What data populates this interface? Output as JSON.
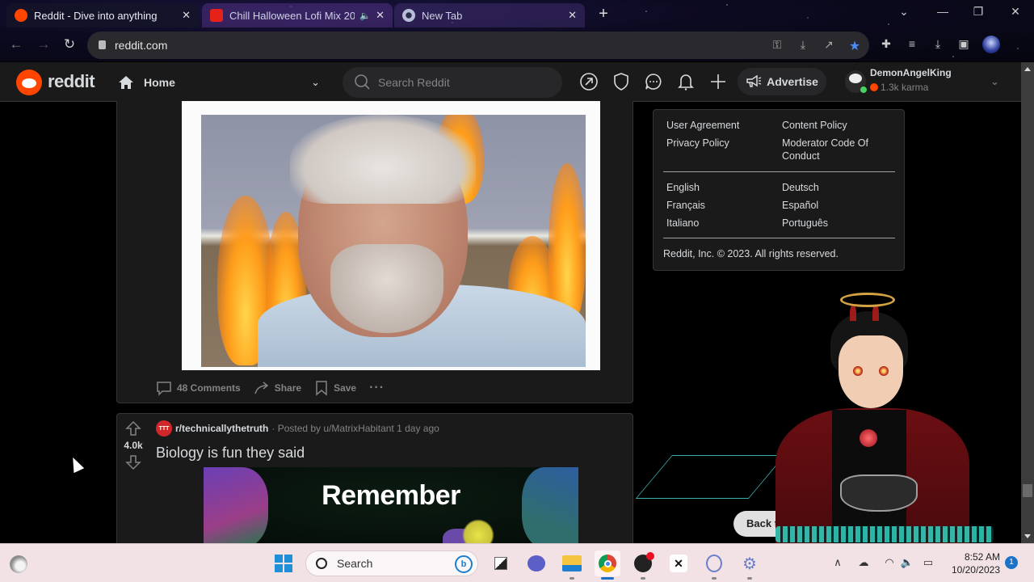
{
  "browser": {
    "tabs": [
      {
        "title": "Reddit - Dive into anything",
        "icon": "reddit-favicon",
        "active": true
      },
      {
        "title": "Chill Halloween Lofi Mix 20",
        "icon": "youtube-favicon",
        "audio": true,
        "active": false
      },
      {
        "title": "New Tab",
        "icon": "chrome-favicon",
        "active": false
      }
    ],
    "new_tab_label": "+",
    "url": "reddit.com",
    "nav": {
      "back": "←",
      "forward": "→",
      "reload": "↻"
    },
    "window_controls": {
      "tab_search": "⌄",
      "minimize": "—",
      "restore": "❐",
      "close": "✕"
    },
    "omnibox_icons": [
      "key-icon",
      "install-icon",
      "share-icon",
      "bookmark-star-icon"
    ],
    "extension_icons": [
      "puzzle-icon",
      "media-icon",
      "download-icon",
      "sidepanel-icon"
    ]
  },
  "reddit": {
    "logo_text": "reddit",
    "feed_selector": {
      "label": "Home"
    },
    "search": {
      "placeholder": "Search Reddit"
    },
    "header_icons": [
      "popular-icon",
      "moderation-icon",
      "chat-icon",
      "notifications-icon",
      "create-post-icon"
    ],
    "advertise_label": "Advertise",
    "user": {
      "name": "DemonAngelKing",
      "karma": "1.3k karma"
    },
    "posts": [
      {
        "actions": {
          "comments": "48 Comments",
          "share": "Share",
          "save": "Save",
          "more": "···"
        }
      },
      {
        "subreddit": "r/technicallythetruth",
        "subreddit_icon_text": "TTT",
        "posted_by": "· Posted by u/MatrixHabitant 1 day ago",
        "score": "4.0k",
        "title": "Biology is fun they said",
        "image_caption": "Remember"
      }
    ],
    "footer": {
      "links_col1": [
        "User Agreement",
        "Privacy Policy"
      ],
      "links_col2": [
        "Content Policy",
        "Moderator Code Of Conduct"
      ],
      "languages_col1": [
        "English",
        "Français",
        "Italiano"
      ],
      "languages_col2": [
        "Deutsch",
        "Español",
        "Português"
      ],
      "copyright": "Reddit, Inc. © 2023. All rights reserved."
    },
    "back_to_top_label": "Back to Top"
  },
  "taskbar": {
    "search_placeholder": "Search",
    "apps": [
      "task-view",
      "teams-meet",
      "file-explorer",
      "chrome",
      "obs",
      "capcut",
      "vtuber-app",
      "settings-app"
    ],
    "time": "8:52 AM",
    "date": "10/20/2023",
    "notification_count": "1"
  }
}
